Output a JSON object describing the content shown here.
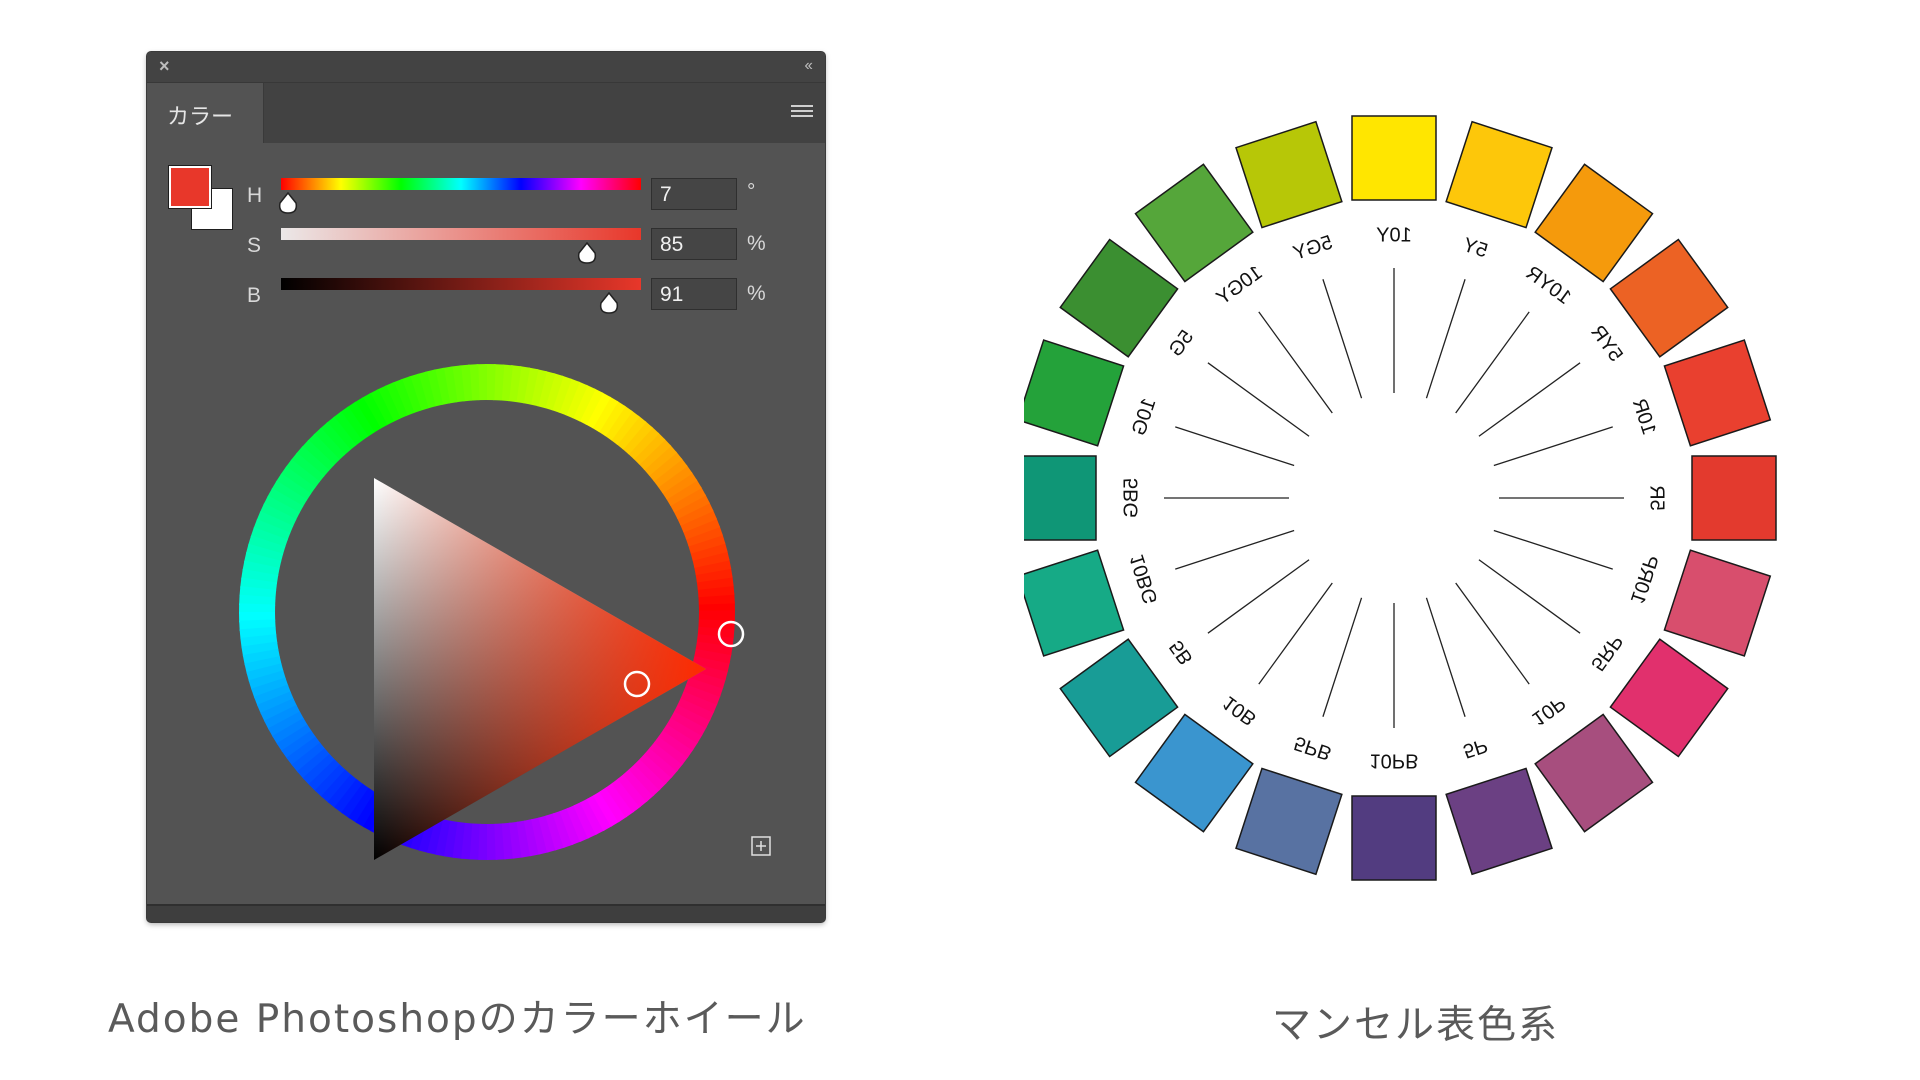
{
  "panel": {
    "tab_label": "カラー",
    "hsb": [
      {
        "label": "H",
        "value": "7",
        "unit": "°",
        "fraction": 0.019
      },
      {
        "label": "S",
        "value": "85",
        "unit": "%",
        "fraction": 0.85
      },
      {
        "label": "B",
        "value": "91",
        "unit": "%",
        "fraction": 0.91
      }
    ],
    "foreground_color": "#e8372a",
    "background_color": "#ffffff"
  },
  "munsell": {
    "hues": [
      {
        "label": "5R",
        "color": "#e33a2e"
      },
      {
        "label": "10R",
        "color": "#e9402f"
      },
      {
        "label": "5YR",
        "color": "#ec6224"
      },
      {
        "label": "10YR",
        "color": "#f59a0c"
      },
      {
        "label": "5Y",
        "color": "#fdc70a"
      },
      {
        "label": "10Y",
        "color": "#ffe600"
      },
      {
        "label": "5GY",
        "color": "#b7c707"
      },
      {
        "label": "10GY",
        "color": "#55a63a"
      },
      {
        "label": "5G",
        "color": "#3b8f31"
      },
      {
        "label": "10G",
        "color": "#24a23a"
      },
      {
        "label": "5BG",
        "color": "#0f9676"
      },
      {
        "label": "10BG",
        "color": "#16aa86"
      },
      {
        "label": "5B",
        "color": "#189c96"
      },
      {
        "label": "10B",
        "color": "#3a95cf"
      },
      {
        "label": "5PB",
        "color": "#5872a2"
      },
      {
        "label": "10PB",
        "color": "#523c80"
      },
      {
        "label": "5P",
        "color": "#6b4083"
      },
      {
        "label": "10P",
        "color": "#a74e7e"
      },
      {
        "label": "5RP",
        "color": "#e1306d"
      },
      {
        "label": "10RP",
        "color": "#d84e6d"
      }
    ]
  },
  "captions": {
    "left": "Adobe Photoshopのカラーホイール",
    "right": "マンセル表色系"
  }
}
